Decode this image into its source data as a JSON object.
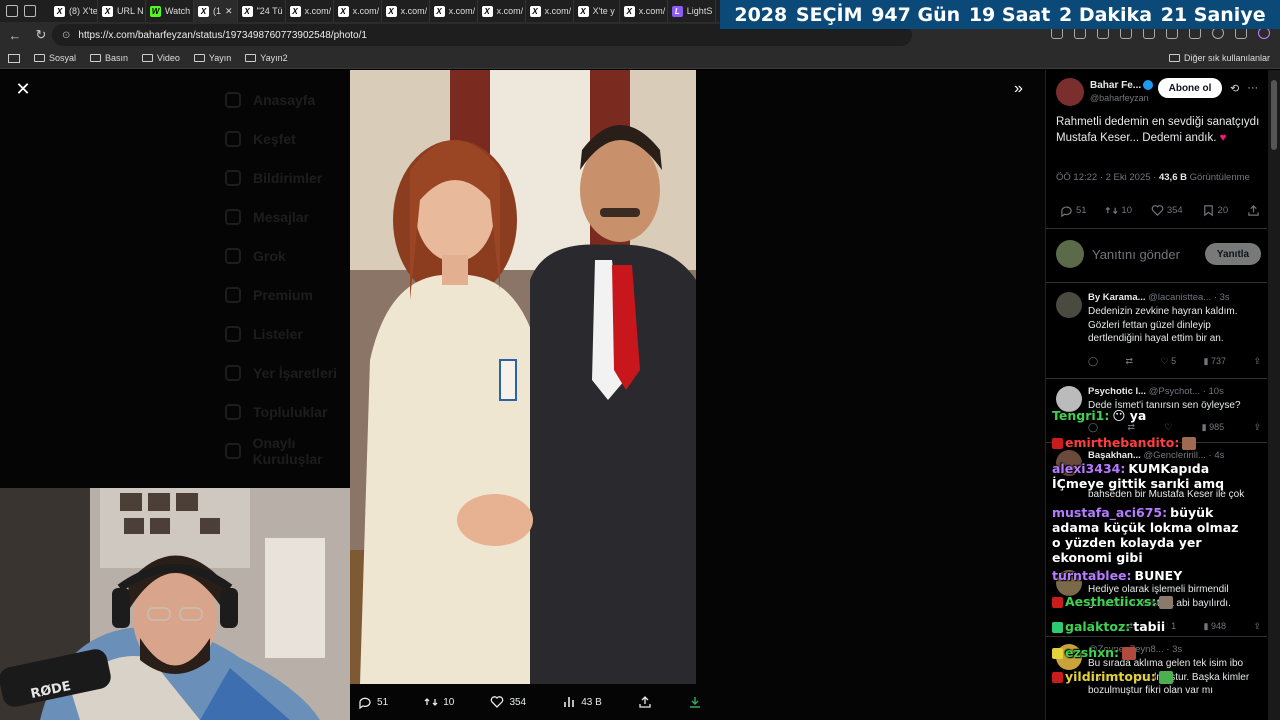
{
  "tabs": [
    {
      "icon": "X",
      "label": "(8) X'te"
    },
    {
      "icon": "X",
      "label": "URL N"
    },
    {
      "icon": "W",
      "label": "Watch"
    },
    {
      "icon": "X",
      "label": "(1"
    },
    {
      "icon": "X",
      "label": "\"24 Tü"
    },
    {
      "icon": "X",
      "label": "x.com/"
    },
    {
      "icon": "X",
      "label": "x.com/"
    },
    {
      "icon": "X",
      "label": "x.com/"
    },
    {
      "icon": "X",
      "label": "x.com/"
    },
    {
      "icon": "X",
      "label": "x.com/"
    },
    {
      "icon": "X",
      "label": "x.com/"
    },
    {
      "icon": "X",
      "label": "X'te y"
    },
    {
      "icon": "X",
      "label": "x.com/"
    },
    {
      "icon": "L",
      "label": "LightS"
    }
  ],
  "countdown": {
    "year": "2028",
    "event": "SEÇİM",
    "days": "947 Gün",
    "hours": "19 Saat",
    "minutes": "2 Dakika",
    "seconds": "21 Saniye"
  },
  "address": {
    "url": "https://x.com/baharfeyzan/status/1973498760773902548/photo/1"
  },
  "bookmarks": {
    "items": [
      "Sosyal",
      "Basın",
      "Video",
      "Yayın",
      "Yayın2"
    ],
    "other": "Diğer sık kullanılanlar"
  },
  "ghost_nav": [
    "Anasayfa",
    "Keşfet",
    "Bildirimler",
    "Mesajlar",
    "Grok",
    "Premium",
    "Listeler",
    "Yer İşaretleri",
    "Topluluklar",
    "Onaylı Kuruluşlar"
  ],
  "photo_actions": {
    "replies": "51",
    "reposts": "10",
    "likes": "354",
    "views": "43 B"
  },
  "tweet": {
    "author_name": "Bahar Fe...",
    "author_handle": "@baharfeyzan",
    "follow_label": "Abone ol",
    "text": "Rahmetli dedemin en sevdiği sanatçıydı Mustafa Keser... Dedemi andık.",
    "heart": "♥",
    "time": "ÖÖ 12:22 · 2 Eki 2025 · ",
    "views": "43,6 B",
    "views_label": " Görüntülenme",
    "replies": "51",
    "reposts": "10",
    "likes": "354",
    "bookmarks": "20"
  },
  "reply_box": {
    "placeholder": "Yanıtını gönder",
    "button": "Yanıtla"
  },
  "replies": [
    {
      "name": "By Karama...",
      "handle": "@lacanisttea... · 3s",
      "text": "Dedenizin zevkine hayran kaldım. Gözleri fettan güzel dinleyip dertlendiğini hayal ettim bir an.",
      "likes": "5",
      "views": "737"
    },
    {
      "name": "Psychotic I...",
      "handle": "@Psychot... · 10s",
      "text": "Dede İsmet'i tanırsın sen öyleyse?",
      "likes": "",
      "views": "985"
    },
    {
      "name": "Başakhan...",
      "handle": "@Gencleririll... · 4s",
      "text": "bahseden bir Mustafa Keser ile çok",
      "likes": "",
      "views": ""
    },
    {
      "name": "",
      "handle": "· 11s",
      "text": "Hediye olarak işlemeli birmendil gönderdim Mustafa abi bayılırdı.",
      "likes": "1",
      "views": "948"
    },
    {
      "name": "",
      "handle": "@ZeynepZeyn8... · 3s",
      "text": "Bu sırada aklıma gelen tek isim ibo sanırım o bozulmuştur. Başka kimler bozulmuştur fikri olan var mı",
      "likes": "",
      "views": ""
    }
  ],
  "chat": [
    {
      "user": "Tengri1:",
      "msg": "😶 ya",
      "color": "#3fd14f"
    },
    {
      "user": "emirthebandito:",
      "msg": "",
      "color": "#ff3e3e"
    },
    {
      "user": "alexi3434:",
      "msg": "KUMKapıda İÇmeye gittik sarıki amq",
      "color": "#b67bff"
    },
    {
      "user": "mustafa_aci675:",
      "msg": "büyük adama küçük lokma olmaz o yüzden kolayda yer ekonomi gibi",
      "color": "#b67bff"
    },
    {
      "user": "turntablee:",
      "msg": "BUNEY",
      "color": "#b67bff"
    },
    {
      "user": "Aesthetiicxs:",
      "msg": "",
      "color": "#3fd14f"
    },
    {
      "user": "galaktoz:",
      "msg": "tabii",
      "color": "#3fd14f"
    },
    {
      "user": "ezshxn:",
      "msg": "",
      "color": "#3fd14f"
    },
    {
      "user": "yildirimtopu:",
      "msg": "",
      "color": "#e3d23a"
    }
  ]
}
